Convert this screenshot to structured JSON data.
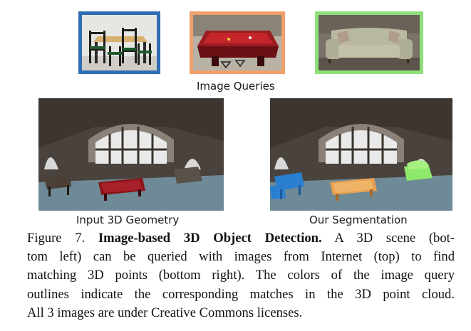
{
  "figure": {
    "queries_label": "Image Queries",
    "left_label": "Input 3D Geometry",
    "right_label": "Our Segmentation",
    "query_outline_colors": {
      "chairs_table": "#2f6db5",
      "pool_table": "#f0a06a",
      "sofa": "#8ee07a"
    },
    "segmentation_colors": {
      "chairs_table": "#2a7fd0",
      "pool_table": "#e8a050",
      "sofa": "#8ee86a"
    }
  },
  "caption": {
    "prefix": "Figure 7.",
    "title": "Image-based 3D Object Detection.",
    "line1_rest": "A 3D scene (bot-",
    "line2": "tom left) can be queried with images from Internet (top) to find",
    "line3": "matching 3D points (bottom right). The colors of the image query",
    "line4": "outlines indicate the corresponding matches in the 3D point cloud.",
    "line5": "All 3 images are under Creative Commons licenses."
  }
}
